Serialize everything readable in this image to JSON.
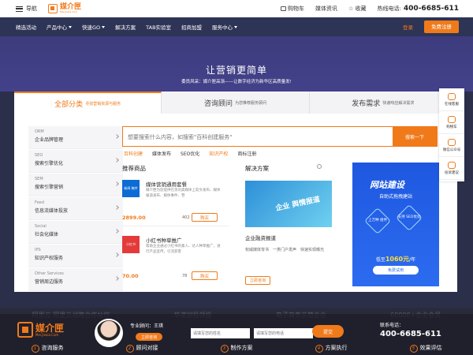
{
  "topbar": {
    "menu_label": "导航",
    "logo_text": "媒介匣",
    "logo_sub": "Mei.Jiexia.Com",
    "cart": "购物车",
    "news": "媒体资讯",
    "favorite": "收藏",
    "hotline_label": "热线电话:",
    "hotline": "400-6685-611"
  },
  "nav": {
    "items": [
      "精选活动",
      "产品中心",
      "快速GO",
      "解决方案",
      "TAB实验室",
      "招商加盟",
      "服务中心"
    ],
    "login": "登录",
    "register": "免费注册"
  },
  "hero": {
    "title": "让营销更简单",
    "subtitle": "委员风采：媒介匣高渐——让数字经济为新华区高质量发!"
  },
  "tabs": [
    {
      "label": "全部分类",
      "sub": "寻找营销资源与服务"
    },
    {
      "label": "咨询顾问",
      "sub": "为您推荐服务顾问"
    },
    {
      "label": "发布需求",
      "sub": "快速响应解决需求"
    }
  ],
  "categories": [
    {
      "en": "ORM",
      "cn": "企业品牌管理"
    },
    {
      "en": "SEO",
      "cn": "搜索引擎优化"
    },
    {
      "en": "SEM",
      "cn": "搜索引擎营销"
    },
    {
      "en": "Feed",
      "cn": "信息流媒体投放"
    },
    {
      "en": "Social",
      "cn": "社会化媒体"
    },
    {
      "en": "IPS",
      "cn": "知识产权服务"
    },
    {
      "en": "Other Services",
      "cn": "营销周边服务"
    }
  ],
  "search": {
    "placeholder": "想要搜索什么内容，如搜索\"百科创建服务\"",
    "button": "搜索一下"
  },
  "hot_tags": [
    "百科创建",
    "媒体发布",
    "SEO优化",
    "知识产权",
    "商标注册"
  ],
  "products": {
    "title": "推荐商品",
    "items": [
      {
        "thumb": "新闻 稿件",
        "name": "媒体营销通用套餐",
        "desc": "媒介匣为您提供在资讯类媒体上软文发布、媒体报道发布、媒体事件、营",
        "price": "2899.00",
        "count": "402",
        "buy": "购买"
      },
      {
        "thumb": "小红书",
        "name": "小红书种草推广",
        "desc": "帮助企业通过小红书的素人、达人种草推广，进行产品宣传，引流获客",
        "price": "70.00",
        "count": "78",
        "buy": "购买"
      }
    ]
  },
  "solutions": {
    "title": "解决方案",
    "image_text": "企业 舆情报道",
    "name": "企业融资报道",
    "desc": "权威媒体背书　一类门户发声　快速实现曝光",
    "button": "立即咨询"
  },
  "banner": {
    "title": "网站建设",
    "subtitle": "自助式拖拽建站",
    "tag1": "上万种 组件",
    "tag2": "支持 SEO优化",
    "price_prefix": "低至",
    "price": "1060元",
    "price_suffix": "/年",
    "button": "免费试用"
  },
  "side": [
    "在线客服",
    "购物车",
    "微信公众号",
    "投诉建议"
  ],
  "strip": [
    "阿里云 阿里云战略合作伙伴",
    "华谊创投领投",
    "电子商务示范企业",
    "60000+企业会员"
  ],
  "footer": {
    "logo": "媒介匣",
    "logo_sub": "Mei.Jiexia.Com",
    "advisor": "专业顾问：王琪",
    "advisor_btn": "立即咨询",
    "name_placeholder": "请填写您的姓名",
    "phone_placeholder": "请填写您的电话",
    "submit": "提交",
    "contact_label": "联系电话：",
    "contact": "400-6685-611",
    "steps": [
      {
        "n": "1",
        "t": "咨询服务"
      },
      {
        "n": "2",
        "t": "顾问对接"
      },
      {
        "n": "3",
        "t": "制作方案"
      },
      {
        "n": "4",
        "t": "方案执行"
      },
      {
        "n": "5",
        "t": "效果评估"
      }
    ]
  },
  "colors": {
    "accent": "#f07a1a",
    "nav": "#2d3456",
    "hero": "#43418a",
    "banner": "#2c6cf0"
  }
}
